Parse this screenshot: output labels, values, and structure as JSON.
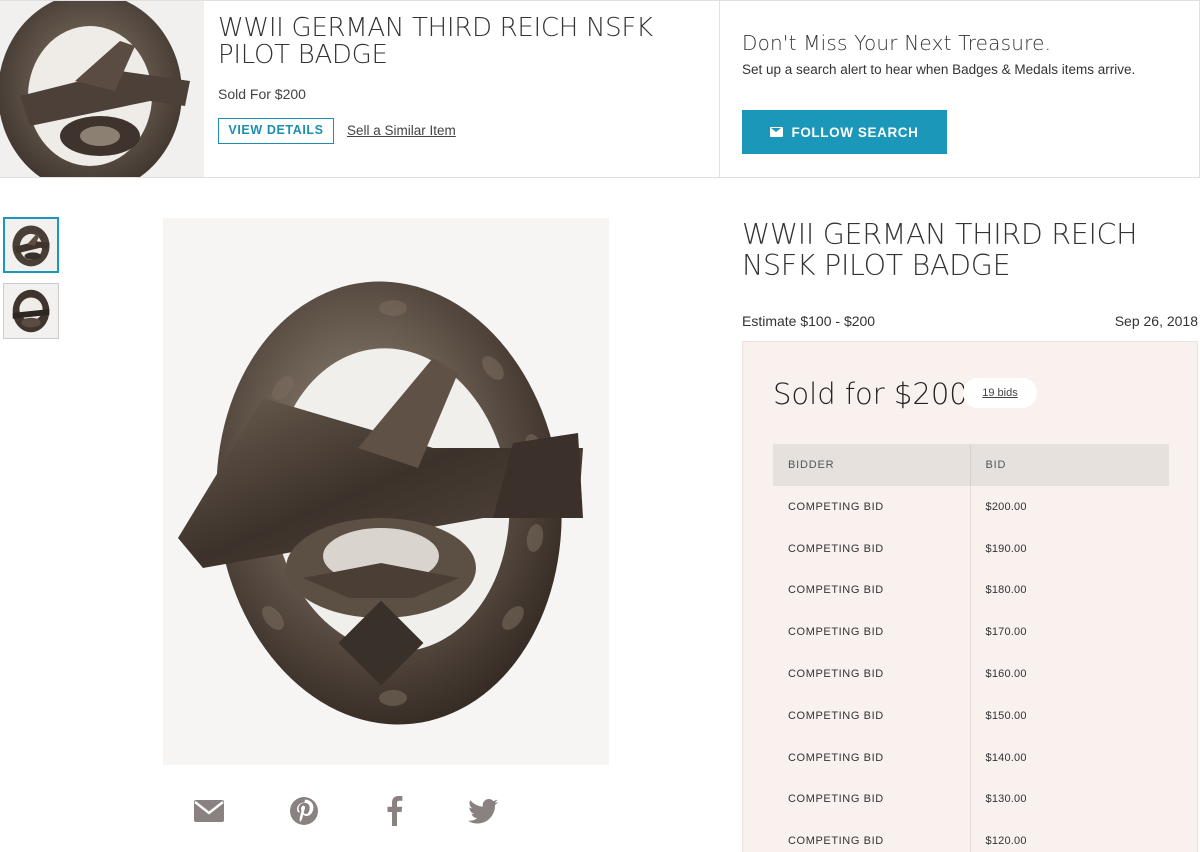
{
  "banner": {
    "title": "WWII GERMAN THIRD REICH NSFK PILOT BADGE",
    "sold_text": "Sold For $200",
    "view_details_label": "VIEW DETAILS",
    "sell_similar_label": "Sell a Similar Item",
    "alert_heading": "Don't Miss Your Next Treasure.",
    "alert_description": "Set up a search alert to hear when Badges & Medals items arrive.",
    "follow_label": "FOLLOW SEARCH",
    "follow_icon": "envelope-icon"
  },
  "gallery": {
    "thumbnails": [
      "badge-front",
      "badge-side"
    ],
    "active_index": 0
  },
  "share": [
    "envelope-icon",
    "pinterest-icon",
    "facebook-icon",
    "twitter-icon"
  ],
  "lot": {
    "title": "WWII GERMAN THIRD REICH NSFK PILOT BADGE",
    "estimate": "Estimate $100 - $200",
    "date": "Sep 26, 2018",
    "sold_for": "Sold for $200",
    "bids_link": "19 bids"
  },
  "bid_table": {
    "headers": [
      "BIDDER",
      "BID"
    ],
    "rows": [
      [
        "COMPETING BID",
        "$200.00"
      ],
      [
        "COMPETING BID",
        "$190.00"
      ],
      [
        "COMPETING BID",
        "$180.00"
      ],
      [
        "COMPETING BID",
        "$170.00"
      ],
      [
        "COMPETING BID",
        "$160.00"
      ],
      [
        "COMPETING BID",
        "$150.00"
      ],
      [
        "COMPETING BID",
        "$140.00"
      ],
      [
        "COMPETING BID",
        "$130.00"
      ],
      [
        "COMPETING BID",
        "$120.00"
      ]
    ]
  },
  "colors": {
    "accent": "#1b97b9",
    "panel_bg": "#f8f1ee",
    "table_header_bg": "#e6e1dd",
    "share_icon": "#8a8280"
  }
}
